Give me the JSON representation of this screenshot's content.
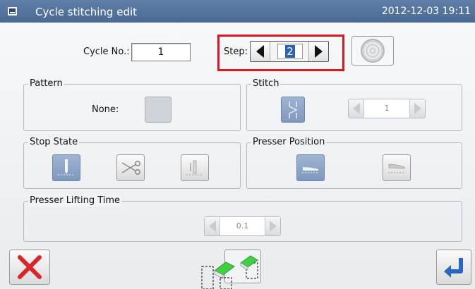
{
  "window": {
    "title": "Cycle stitching edit",
    "datetime": "2012-12-03  19:11"
  },
  "cycle": {
    "label": "Cycle No.:",
    "value": "1"
  },
  "step": {
    "label": "Step:",
    "value": "2"
  },
  "pattern": {
    "title": "Pattern",
    "none_label": "None:"
  },
  "stitch": {
    "title": "Stitch",
    "spin_value": "1"
  },
  "stop_state": {
    "title": "Stop State",
    "options": [
      "needle-up-icon",
      "scissors-icon",
      "needle-down-icon"
    ],
    "selected": 0
  },
  "presser_position": {
    "title": "Presser Position",
    "options": [
      "presser-down-icon",
      "presser-up-icon"
    ],
    "selected": 0
  },
  "presser_lifting_time": {
    "title": "Presser Lifting Time",
    "value": "0.1"
  },
  "colors": {
    "title_bar": "#4f6f99",
    "highlight": "#e0161e",
    "selected": "#8ea5c7",
    "cancel": "#d9262b",
    "confirm": "#2a66c2",
    "erase_green": "#3fd13f"
  }
}
